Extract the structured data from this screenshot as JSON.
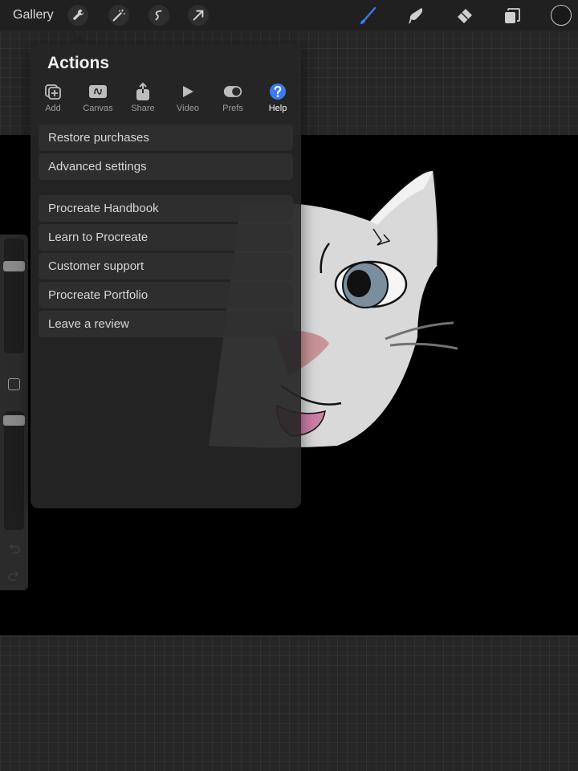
{
  "topbar": {
    "gallery_label": "Gallery",
    "left_tools": [
      "wrench-icon",
      "magic-wand-icon",
      "selection-icon",
      "transform-arrow-icon"
    ],
    "right_tools": [
      "brush-icon",
      "smudge-icon",
      "eraser-icon",
      "layers-icon",
      "color-icon"
    ],
    "accent_color": "#3a7bf2"
  },
  "actions_panel": {
    "title": "Actions",
    "tabs": [
      {
        "label": "Add",
        "icon": "add-icon"
      },
      {
        "label": "Canvas",
        "icon": "canvas-icon"
      },
      {
        "label": "Share",
        "icon": "share-icon"
      },
      {
        "label": "Video",
        "icon": "video-play-icon"
      },
      {
        "label": "Prefs",
        "icon": "toggle-icon"
      },
      {
        "label": "Help",
        "icon": "help-icon",
        "active": true
      }
    ],
    "group1": [
      "Restore purchases",
      "Advanced settings"
    ],
    "group2": [
      "Procreate Handbook",
      "Learn to Procreate",
      "Customer support",
      "Procreate Portfolio",
      "Leave a review"
    ]
  },
  "sidebar": {
    "brush_size_level": 0.8,
    "opacity_level": 0.95
  }
}
